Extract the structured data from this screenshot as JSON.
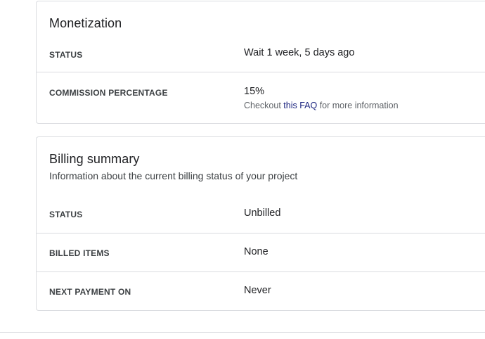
{
  "monetization": {
    "title": "Monetization",
    "rows": [
      {
        "label": "STATUS",
        "value": "Wait 1 week, 5 days ago"
      },
      {
        "label": "COMMISSION PERCENTAGE",
        "value": "15%",
        "note_prefix": "Checkout ",
        "note_link": "this FAQ",
        "note_suffix": " for more information"
      }
    ]
  },
  "billing": {
    "title": "Billing summary",
    "subtitle": "Information about the current billing status of your project",
    "rows": [
      {
        "label": "STATUS",
        "value": "Unbilled"
      },
      {
        "label": "BILLED ITEMS",
        "value": "None"
      },
      {
        "label": "NEXT PAYMENT ON",
        "value": "Never"
      }
    ]
  },
  "colors": {
    "link": "#1a237e",
    "divider": "#dadce0",
    "text": "#202124",
    "muted": "#5f6368"
  }
}
